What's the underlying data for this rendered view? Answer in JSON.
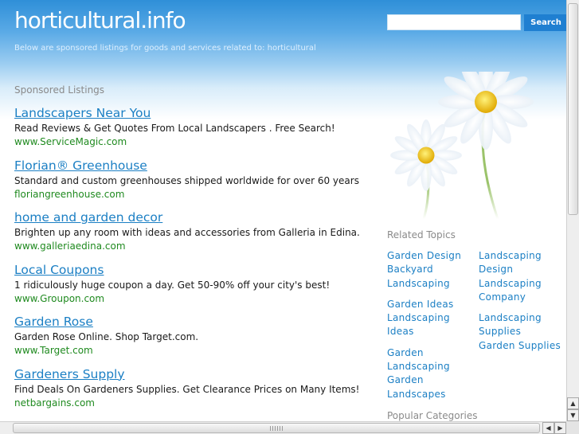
{
  "header": {
    "title": "horticultural.info",
    "subtitle": "Below are sponsored listings for goods and services related to: horticultural"
  },
  "search": {
    "button_label": "Search",
    "value": ""
  },
  "sponsored": {
    "heading": "Sponsored Listings",
    "items": [
      {
        "title": "Landscapers Near You",
        "desc": "Read Reviews & Get Quotes From Local Landscapers . Free Search!",
        "url": "www.ServiceMagic.com"
      },
      {
        "title": "Florian® Greenhouse",
        "desc": "Standard and custom greenhouses shipped worldwide for over 60 years",
        "url": "floriangreenhouse.com"
      },
      {
        "title": "home and garden decor",
        "desc": "Brighten up any room with ideas and accessories from Galleria in Edina.",
        "url": "www.galleriaedina.com"
      },
      {
        "title": "Local Coupons",
        "desc": "1 ridiculously huge coupon a day. Get 50-90% off your city's best!",
        "url": "www.Groupon.com"
      },
      {
        "title": "Garden Rose",
        "desc": "Garden Rose Online. Shop Target.com.",
        "url": "www.Target.com"
      },
      {
        "title": "Gardeners Supply",
        "desc": "Find Deals On Gardeners Supplies. Get Clearance Prices on Many Items!",
        "url": "netbargains.com"
      }
    ]
  },
  "related": {
    "heading": "Related Topics",
    "col1": [
      "Garden Design",
      "Backyard Landscaping",
      "Garden Ideas",
      "Landscaping Ideas",
      "Garden Landscaping",
      "Garden Landscapes"
    ],
    "col2": [
      "Landscaping Design",
      "Landscaping Company",
      "Landscaping Supplies",
      "Garden Supplies"
    ]
  },
  "popular": {
    "heading": "Popular Categories"
  },
  "colors": {
    "link": "#1b7fc4",
    "url_green": "#1f8a1f",
    "header_blue": "#2f8fd8",
    "search_button": "#1f7fd1"
  },
  "icons": {
    "scroll_up": "▲",
    "scroll_down": "▼",
    "scroll_left": "◀",
    "scroll_right": "▶"
  }
}
